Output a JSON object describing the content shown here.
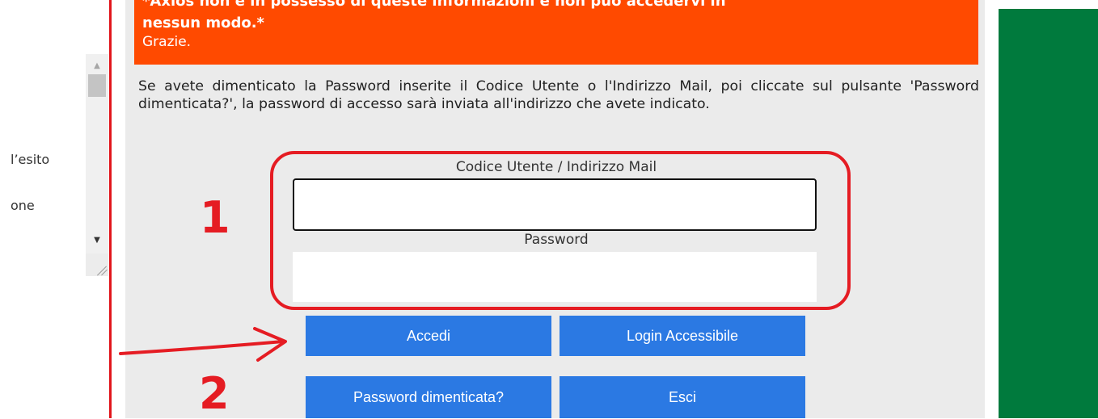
{
  "left_panel": {
    "text_line_1": "l’esito",
    "text_line_2": "one"
  },
  "warning": {
    "line1": "*Axios non è in possesso di queste informazioni e non può accedervi in",
    "line2": "nessun modo.*",
    "line3": "Grazie."
  },
  "instructions": "Se avete dimenticato la Password inserite il Codice Utente o l'Indirizzo Mail, poi cliccate sul pulsante 'Password dimenticata?', la password di accesso sarà inviata all'indirizzo che avete indicato.",
  "form": {
    "user_label": "Codice Utente / Indirizzo Mail",
    "user_value": "",
    "password_label": "Password",
    "password_value": ""
  },
  "buttons": {
    "accedi": "Accedi",
    "login_accessibile": "Login Accessibile",
    "password_dimenticata": "Password dimenticata?",
    "esci": "Esci"
  },
  "annotations": {
    "step1": "1",
    "step2": "2"
  },
  "colors": {
    "warning_bg": "#ff4a00",
    "button_blue": "#2b79e3",
    "green_bar": "#007a3d",
    "annotation_red": "#e51c23"
  },
  "icons": {
    "scroll_up": "triangle-up",
    "scroll_down": "triangle-down",
    "resize_grip": "diagonal-lines"
  }
}
